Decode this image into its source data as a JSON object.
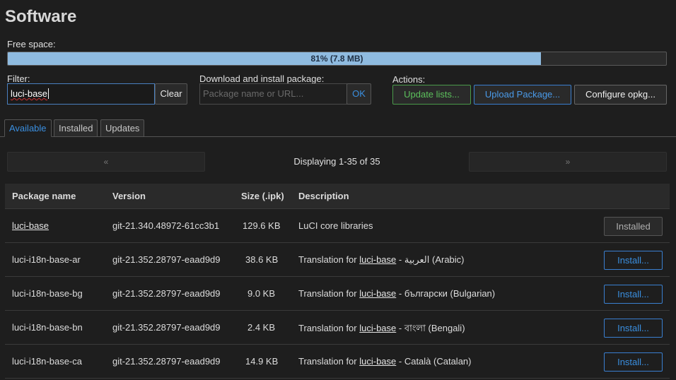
{
  "page": {
    "title": "Software"
  },
  "free_space": {
    "label": "Free space:",
    "text": "81% (7.8 MB)",
    "fraction": 0.81
  },
  "filter": {
    "label": "Filter:",
    "value": "luci-base",
    "clear_label": "Clear"
  },
  "download": {
    "label": "Download and install package:",
    "placeholder": "Package name or URL...",
    "ok_label": "OK"
  },
  "actions": {
    "label": "Actions:",
    "update_lists": "Update lists...",
    "upload_package": "Upload Package...",
    "configure_opkg": "Configure opkg..."
  },
  "tabs": [
    {
      "label": "Available",
      "active": true
    },
    {
      "label": "Installed",
      "active": false
    },
    {
      "label": "Updates",
      "active": false
    }
  ],
  "pager": {
    "prev": "«",
    "next": "»",
    "text": "Displaying 1-35 of 35"
  },
  "table": {
    "headers": {
      "name": "Package name",
      "version": "Version",
      "size": "Size (.ipk)",
      "description": "Description"
    },
    "rows": [
      {
        "name": "luci-base",
        "version": "git-21.340.48972-61cc3b1",
        "size": "129.6 KB",
        "description": "LuCI core libraries",
        "action": "Installed"
      },
      {
        "name": "luci-i18n-base-ar",
        "version": "git-21.352.28797-eaad9d9",
        "size": "38.6 KB",
        "desc_prefix": "Translation for",
        "desc_link": "luci-base",
        "desc_suffix": "- العربية (Arabic)",
        "action": "Install..."
      },
      {
        "name": "luci-i18n-base-bg",
        "version": "git-21.352.28797-eaad9d9",
        "size": "9.0 KB",
        "desc_prefix": "Translation for",
        "desc_link": "luci-base",
        "desc_suffix": "- български (Bulgarian)",
        "action": "Install..."
      },
      {
        "name": "luci-i18n-base-bn",
        "version": "git-21.352.28797-eaad9d9",
        "size": "2.4 KB",
        "desc_prefix": "Translation for",
        "desc_link": "luci-base",
        "desc_suffix": "- বাংলা (Bengali)",
        "action": "Install..."
      },
      {
        "name": "luci-i18n-base-ca",
        "version": "git-21.352.28797-eaad9d9",
        "size": "14.9 KB",
        "desc_prefix": "Translation for",
        "desc_link": "luci-base",
        "desc_suffix": "- Català (Catalan)",
        "action": "Install..."
      }
    ]
  }
}
